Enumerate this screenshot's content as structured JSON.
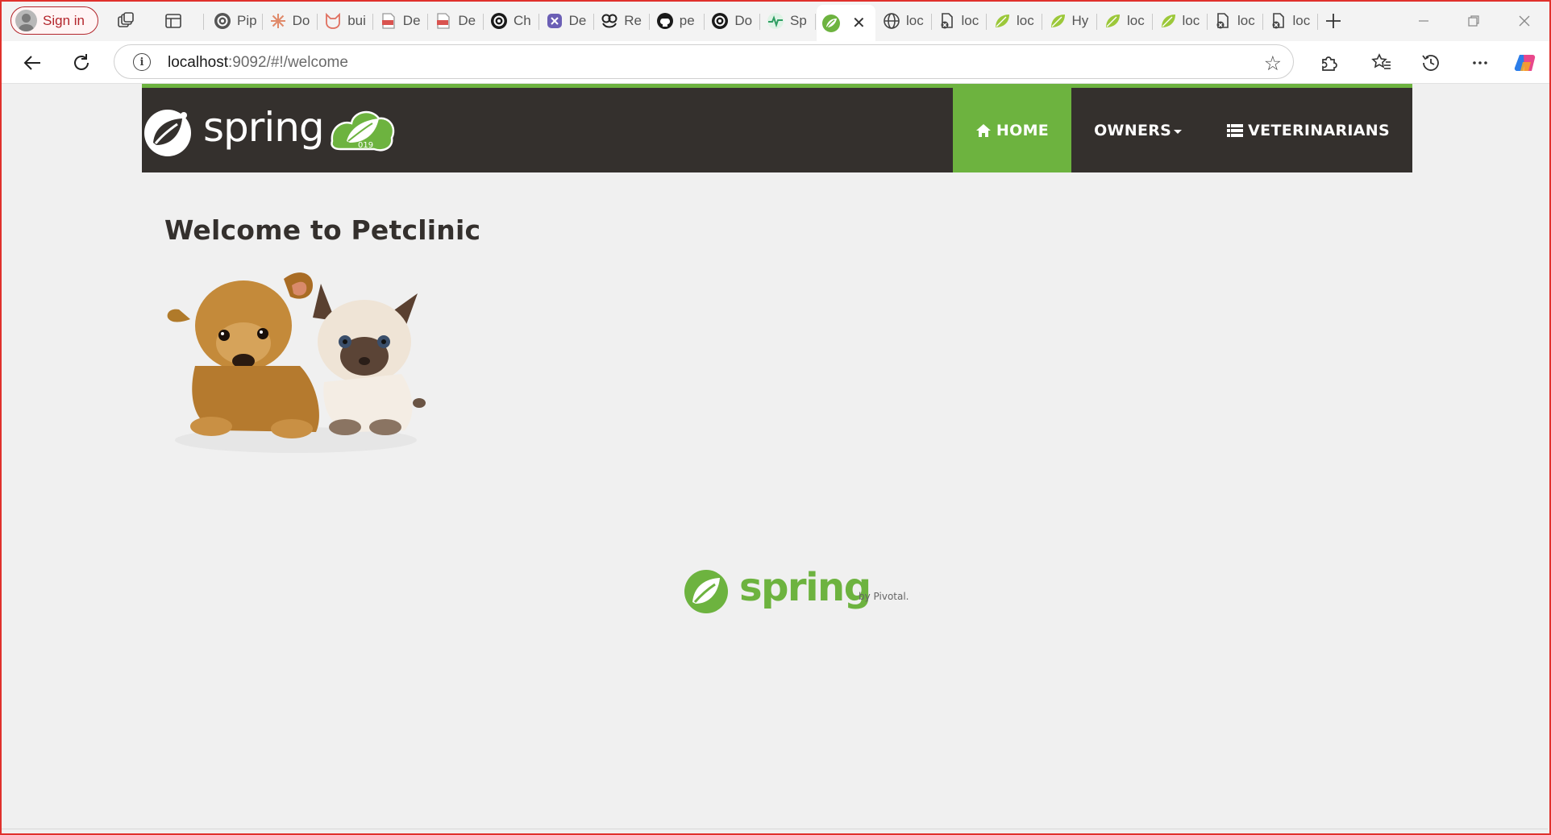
{
  "browser": {
    "signin_label": "Sign in",
    "tabs": [
      {
        "label": "Pip",
        "icon": "openai-icon",
        "color": "#555555"
      },
      {
        "label": "Do",
        "icon": "asterisk-icon",
        "color": "#e08a6a"
      },
      {
        "label": "bui",
        "icon": "fox-icon",
        "color": "#e07060"
      },
      {
        "label": "De",
        "icon": "pdf-icon",
        "color": "#d9534f"
      },
      {
        "label": "De",
        "icon": "pdf-icon",
        "color": "#d9534f"
      },
      {
        "label": "Ch",
        "icon": "openai-icon",
        "color": "#1a1a1a"
      },
      {
        "label": "De",
        "icon": "app-icon",
        "color": "#6b5fb5"
      },
      {
        "label": "Re",
        "icon": "bot-icon",
        "color": "#222222"
      },
      {
        "label": "pe",
        "icon": "github-icon",
        "color": "#1a1a1a"
      },
      {
        "label": "Do",
        "icon": "openai-icon",
        "color": "#1a1a1a"
      },
      {
        "label": "Sp",
        "icon": "pulse-icon",
        "color": "#2e9e62"
      }
    ],
    "active_tab": {
      "label": "",
      "icon": "spring-leaf-icon",
      "color": "#6db33f"
    },
    "tabs_after": [
      {
        "label": "loc",
        "icon": "globe-icon",
        "color": "#444444"
      },
      {
        "label": "loc",
        "icon": "file-error-icon",
        "color": "#444444"
      },
      {
        "label": "loc",
        "icon": "spring-leaf-icon",
        "color": "#9cc83a"
      },
      {
        "label": "Hy",
        "icon": "spring-leaf-icon",
        "color": "#9cc83a"
      },
      {
        "label": "loc",
        "icon": "spring-leaf-icon",
        "color": "#9cc83a"
      },
      {
        "label": "loc",
        "icon": "spring-leaf-icon",
        "color": "#9cc83a"
      },
      {
        "label": "loc",
        "icon": "file-error-icon",
        "color": "#444444"
      },
      {
        "label": "loc",
        "icon": "file-error-icon",
        "color": "#444444"
      }
    ],
    "url_host": "localhost",
    "url_path": ":9092/#!/welcome"
  },
  "app": {
    "brand_word": "spring",
    "brand_badge": "019",
    "nav": {
      "home": "HOME",
      "owners": "OWNERS",
      "vets": "VETERINARIANS"
    },
    "welcome_title": "Welcome to Petclinic",
    "footer_word": "spring",
    "footer_by": "by Pivotal.",
    "colors": {
      "accent": "#6db33f",
      "navbar": "#34302d",
      "text": "#34302d"
    }
  }
}
